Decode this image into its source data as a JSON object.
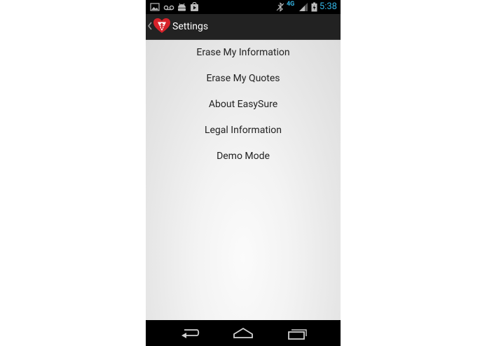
{
  "status_bar": {
    "time": "5:38",
    "network": "4G",
    "accent_color": "#33b5e5",
    "icons": [
      "gallery-icon",
      "voicemail-icon",
      "android-icon",
      "play-store-icon",
      "bluetooth-icon",
      "signal-icon",
      "battery-icon"
    ]
  },
  "action_bar": {
    "title": "Settings",
    "logo": "heart-medical-logo",
    "up": "up-caret-icon"
  },
  "menu": {
    "items": [
      {
        "label": "Erase My Information"
      },
      {
        "label": "Erase My Quotes"
      },
      {
        "label": "About EasySure"
      },
      {
        "label": "Legal Information"
      },
      {
        "label": "Demo Mode"
      }
    ]
  },
  "nav_bar": {
    "buttons": [
      "back-icon",
      "home-icon",
      "recents-icon"
    ]
  }
}
